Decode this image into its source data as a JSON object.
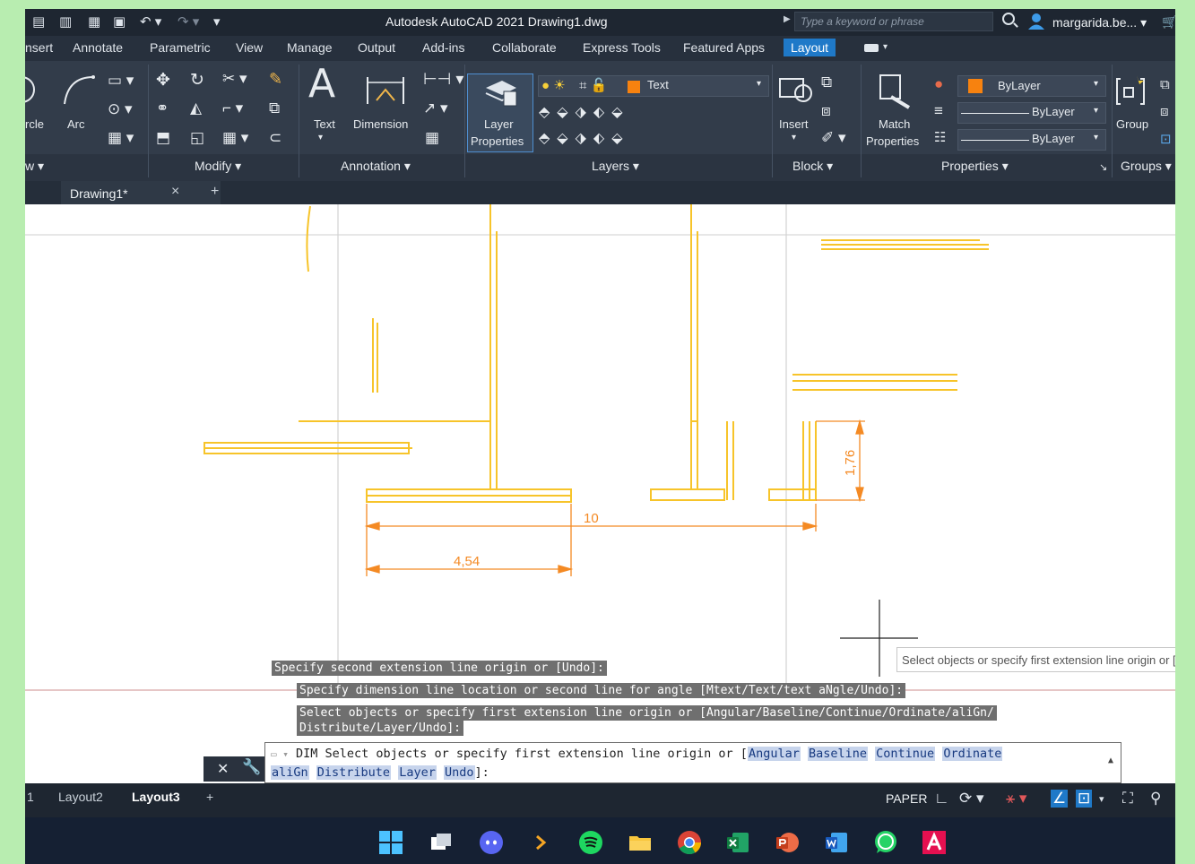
{
  "window": {
    "title": "Autodesk AutoCAD 2021  Drawing1.dwg",
    "search_placeholder": "Type a keyword or phrase",
    "user": "margarida.be...",
    "user_caret": "▾"
  },
  "ribbon_tabs": [
    "nsert",
    "Annotate",
    "Parametric",
    "View",
    "Manage",
    "Output",
    "Add-ins",
    "Collaborate",
    "Express Tools",
    "Featured Apps",
    "Layout"
  ],
  "ribbon": {
    "draw": {
      "circle_label": "rcle",
      "arc_label": "Arc",
      "panel": "w ▾"
    },
    "modify": {
      "panel": "Modify ▾"
    },
    "annotation": {
      "text_label": "Text",
      "dimension_label": "Dimension",
      "panel": "Annotation ▾"
    },
    "layers": {
      "layer_properties_label_1": "Layer",
      "layer_properties_label_2": "Properties",
      "current_layer": "Text",
      "panel": "Layers ▾"
    },
    "block": {
      "insert_label": "Insert",
      "panel": "Block ▾"
    },
    "properties": {
      "match_label_1": "Match",
      "match_label_2": "Properties",
      "color_value": "ByLayer",
      "linetype_value": "ByLayer",
      "lineweight_value": "ByLayer",
      "panel": "Properties ▾",
      "panel_arrow": "↘"
    },
    "groups": {
      "group_label": "Group",
      "panel": "Groups ▾"
    }
  },
  "file_tabs": {
    "current": "Drawing1*",
    "close": "×",
    "add": "+"
  },
  "drawing": {
    "dim_total": "10",
    "dim_partial": "4,54",
    "dim_vertical": "1,76"
  },
  "command_history": [
    "Specify second extension line origin or [Undo]:",
    "Specify dimension line location or second line for angle [Mtext/Text/text aNgle/Undo]:",
    "Select objects or specify first extension line origin or [Angular/Baseline/Continue/Ordinate/aliGn/",
    "Distribute/Layer/Undo]:"
  ],
  "tooltip": "Select objects or specify first extension line origin or [Angular/Baseline]",
  "command_line": {
    "prefix": "DIM Select objects or specify first extension line origin or [",
    "options_line1": [
      "Angular",
      "Baseline",
      "Continue",
      "Ordinate"
    ],
    "options_line2": [
      "aliGn",
      "Distribute",
      "Layer",
      "Undo"
    ],
    "suffix": "]:"
  },
  "layout_tabs": [
    "1",
    "Layout2",
    "Layout3"
  ],
  "layout_add": "+",
  "status": {
    "space": "PAPER"
  },
  "colors": {
    "geometry": "#f7c42a",
    "dimension": "#f48a24",
    "ribbon_bg": "#323c4a",
    "accent": "#1f79c8"
  }
}
